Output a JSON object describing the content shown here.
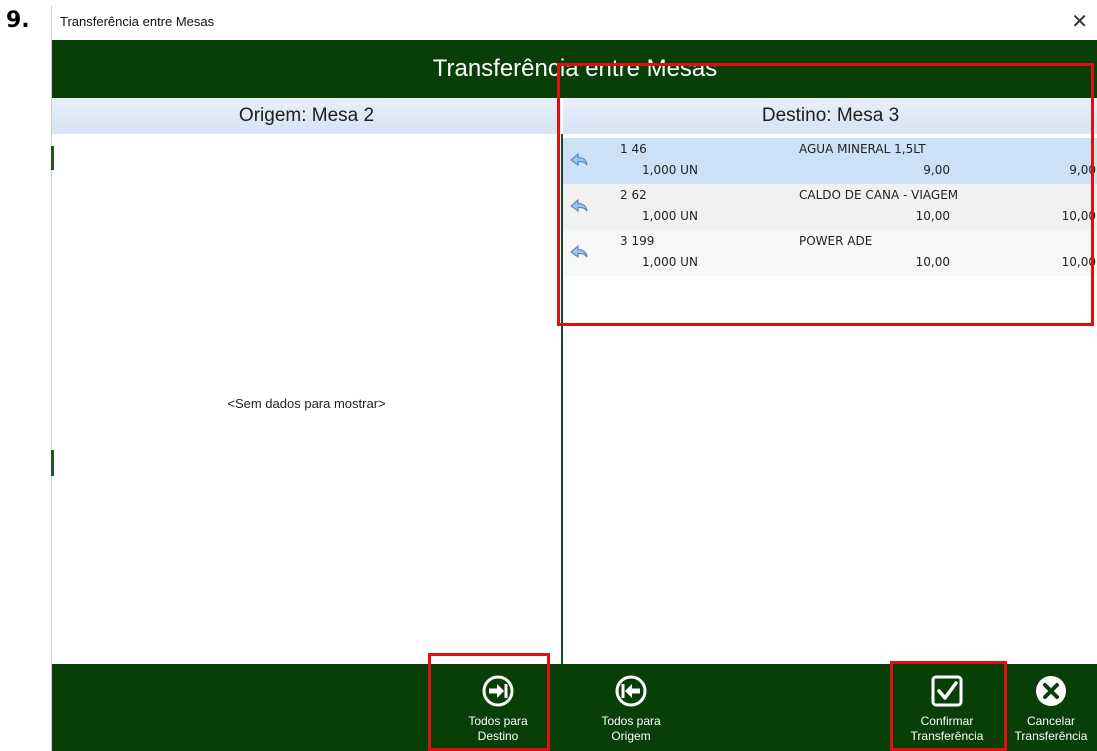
{
  "step_number": "9.",
  "window": {
    "title": "Transferência entre Mesas",
    "close_glyph": "✕"
  },
  "header": {
    "title": "Transferência entre Mesas"
  },
  "origin": {
    "label": "Origem: Mesa 2",
    "empty_text": "<Sem dados para mostrar>"
  },
  "destination": {
    "label": "Destino: Mesa 3",
    "items": [
      {
        "num": "1 46",
        "description": "AGUA MINERAL 1,5LT",
        "qty": "1,000 UN",
        "unit_price": "9,00",
        "total": "9,00",
        "selected": true
      },
      {
        "num": "2 62",
        "description": "CALDO DE CANA - VIAGEM",
        "qty": "1,000 UN",
        "unit_price": "10,00",
        "total": "10,00",
        "selected": false
      },
      {
        "num": "3 199",
        "description": "POWER ADE",
        "qty": "1,000 UN",
        "unit_price": "10,00",
        "total": "10,00",
        "selected": false
      }
    ]
  },
  "footer": {
    "all_to_destination": {
      "line1": "Todos para",
      "line2": "Destino",
      "icon": "arrow-right-circle-icon"
    },
    "all_to_origin": {
      "line1": "Todos para",
      "line2": "Origem",
      "icon": "arrow-left-circle-icon"
    },
    "confirm": {
      "line1": "Confirmar",
      "line2": "Transferência",
      "icon": "checkbox-icon"
    },
    "cancel": {
      "line1": "Cancelar",
      "line2": "Transferência",
      "icon": "x-circle-icon"
    }
  },
  "colors": {
    "header_green": "#083f07",
    "selected_row": "#cde1f6",
    "highlight_red": "#e01010"
  }
}
